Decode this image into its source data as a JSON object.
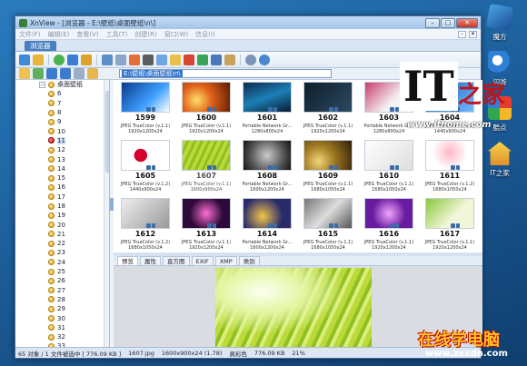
{
  "window": {
    "title": "XnView - [浏览器 - E:\\壁纸\\桌面壁纸\\n\\]",
    "min_label": "–",
    "max_label": "□",
    "close_label": "✕"
  },
  "menu": [
    "文件(F)",
    "编辑(E)",
    "查看(V)",
    "工具(T)",
    "创建(R)",
    "窗口(W)",
    "信息(I)"
  ],
  "main_tab": "浏览器",
  "path": "E:\\壁纸\\桌面壁纸\\n\\",
  "tree": {
    "root_label": "桌面壁纸",
    "folders": [
      "6",
      "7",
      "8",
      "9",
      "10",
      "11",
      "12",
      "13",
      "14",
      "15",
      "16",
      "17",
      "18",
      "19",
      "20",
      "21",
      "22",
      "23",
      "24",
      "25",
      "26",
      "27",
      "28",
      "29",
      "30",
      "31",
      "32",
      "33"
    ],
    "selected": "11"
  },
  "thumbnails": [
    {
      "name": "1599",
      "info1": "JPEG TrueColor (v.1.1)",
      "info2": "1920x1200x24"
    },
    {
      "name": "1600",
      "info1": "JPEG TrueColor (v.1.1)",
      "info2": "1920x1200x24"
    },
    {
      "name": "1601",
      "info1": "Portable Network Gr...",
      "info2": "1280x800x24"
    },
    {
      "name": "1602",
      "info1": "JPEG TrueColor (v.1.1)",
      "info2": "1920x1200x24"
    },
    {
      "name": "1603",
      "info1": "Portable Network Gr...",
      "info2": "1280x800x24"
    },
    {
      "name": "1604",
      "info1": "JPEG TrueColor (v.1.1)",
      "info2": "1440x900x24"
    },
    {
      "name": "1605",
      "info1": "JPEG TrueColor (v.1.2)",
      "info2": "1440x900x24"
    },
    {
      "name": "1607",
      "info1": "JPEG TrueColor (v.1.1)",
      "info2": "1600x900x24"
    },
    {
      "name": "1608",
      "info1": "Portable Network Gr...",
      "info2": "1600x1200x24"
    },
    {
      "name": "1609",
      "info1": "JPEG TrueColor (v.1.1)",
      "info2": "1680x1050x24"
    },
    {
      "name": "1610",
      "info1": "JPEG TrueColor (v.1.1)",
      "info2": "1680x1050x24"
    },
    {
      "name": "1611",
      "info1": "JPEG TrueColor (v.1.2)",
      "info2": "1680x1050x24"
    },
    {
      "name": "1612",
      "info1": "JPEG TrueColor (v.1.2)",
      "info2": "1680x1050x24"
    },
    {
      "name": "1613",
      "info1": "JPEG TrueColor (v.1.1)",
      "info2": "1920x1200x24"
    },
    {
      "name": "1614",
      "info1": "Portable Network Gr...",
      "info2": "1600x1200x24"
    },
    {
      "name": "1615",
      "info1": "JPEG TrueColor (v.1.1)",
      "info2": "1680x1050x24"
    },
    {
      "name": "1616",
      "info1": "JPEG TrueColor (v.1.1)",
      "info2": "1920x1200x24"
    },
    {
      "name": "1617",
      "info1": "JPEG TrueColor (v.1.1)",
      "info2": "1920x1200x24"
    }
  ],
  "selected_thumbnail": "1607",
  "preview_tabs": [
    "预览",
    "属性",
    "直方图",
    "EXIF",
    "XMP",
    "类别"
  ],
  "status": {
    "count": "65 对象 / 1 文件被选中 [ 776.09 KB ]",
    "file": "1607.jpg",
    "dims": "1600x900x24 (1.78)",
    "color": "真彩色",
    "size": "776.09 KB",
    "zoom": "21%"
  },
  "desktop_icons": [
    {
      "label": "魔方",
      "icon": "cube-icon"
    },
    {
      "label": "闪游",
      "icon": "flash-icon"
    },
    {
      "label": "酷点",
      "icon": "pinwheel-icon"
    },
    {
      "label": "IT之家",
      "icon": "home-icon"
    }
  ],
  "watermarks": {
    "it_logo": "IT",
    "it_logo_char": "之家",
    "it_url": "www.ithome.com",
    "zx_logo": "在线学电脑",
    "zx_url": "www.zxxdn.com"
  }
}
